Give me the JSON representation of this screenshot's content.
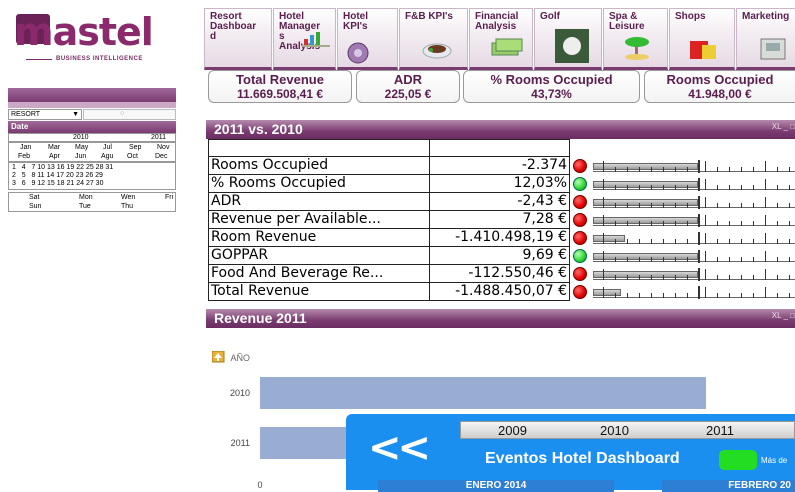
{
  "logo": {
    "text": "mastel",
    "subtitle": "BUSINESS INTELLIGENCE"
  },
  "nav": {
    "tabs": [
      {
        "label": "Resort\nDashboar\nd"
      },
      {
        "label": "Hotel\nManager\ns\nAnalysis"
      },
      {
        "label": "Hotel\nKPI's"
      },
      {
        "label": "F&B KPI's"
      },
      {
        "label": "Financial\nAnalysis"
      },
      {
        "label": "Golf"
      },
      {
        "label": "Spa &\nLeisure"
      },
      {
        "label": "Shops"
      },
      {
        "label": "Marketing"
      }
    ]
  },
  "sidebar": {
    "resort_select": "RESORT",
    "date_label": "Date",
    "years": [
      "2010",
      "2011"
    ],
    "months": [
      "Jan",
      "Feb",
      "Mar",
      "Apr",
      "May",
      "Jun",
      "Jul",
      "Agu",
      "Sep",
      "Oct",
      "Nov",
      "Dec"
    ],
    "days_rows": [
      "1   4   7 10 13 16 19 22 25 28 31",
      "2   5   8 11 14 17 20 23 26 29",
      "3   6   9 12 15 18 21 24 27 30"
    ],
    "weekdays": [
      "Sat",
      "Mon",
      "Wen",
      "Fri",
      "Sun",
      "Tue",
      "Thu"
    ]
  },
  "kpis": [
    {
      "title": "Total Revenue",
      "value": "11.669.508,41 €"
    },
    {
      "title": "ADR",
      "value": "225,05 €"
    },
    {
      "title": "% Rooms Occupied",
      "value": "43,73%"
    },
    {
      "title": "Rooms Occupied",
      "value": "41.948,00 €"
    }
  ],
  "comparison": {
    "title": "2011 vs. 2010",
    "controls": "XL _ □",
    "rows": [
      {
        "name": "Rooms Occupied",
        "value": "-2.374",
        "status": "red",
        "level": 0.52
      },
      {
        "name": "% Rooms Occupied",
        "value": "12,03%",
        "status": "green",
        "level": 0.52
      },
      {
        "name": "ADR",
        "value": "-2,43 €",
        "status": "red",
        "level": 0.52
      },
      {
        "name": "Revenue per Available...",
        "value": "7,28 €",
        "status": "red",
        "level": 0.52
      },
      {
        "name": "Room Revenue",
        "value": "-1.410.498,19 €",
        "status": "red",
        "level": 0.16
      },
      {
        "name": "GOPPAR",
        "value": "9,69 €",
        "status": "green",
        "level": 0.52
      },
      {
        "name": "Food And Beverage Re...",
        "value": "-112.550,46 €",
        "status": "red",
        "level": 0.52
      },
      {
        "name": "Total Revenue",
        "value": "-1.488.450,07 €",
        "status": "red",
        "level": 0.14
      }
    ]
  },
  "revenue": {
    "title": "Revenue 2011",
    "controls": "XL _ □",
    "axis_toggle": "AÑO"
  },
  "chart_data": {
    "type": "bar",
    "orientation": "horizontal",
    "categories": [
      "2010",
      "2011"
    ],
    "series": [
      {
        "values": [
          1,
          1
        ]
      }
    ],
    "tick_labels": [
      "0"
    ]
  },
  "events": {
    "years": [
      "2009",
      "2010",
      "2011"
    ],
    "back": "<<",
    "title": "Eventos Hotel Dashboard",
    "more": "Más de",
    "months": [
      "ENERO 2014",
      "FEBRERO 20"
    ]
  },
  "colors": {
    "brand": "#7a3b70",
    "events_bg": "#1a8ff0",
    "bar": "#98add1"
  }
}
